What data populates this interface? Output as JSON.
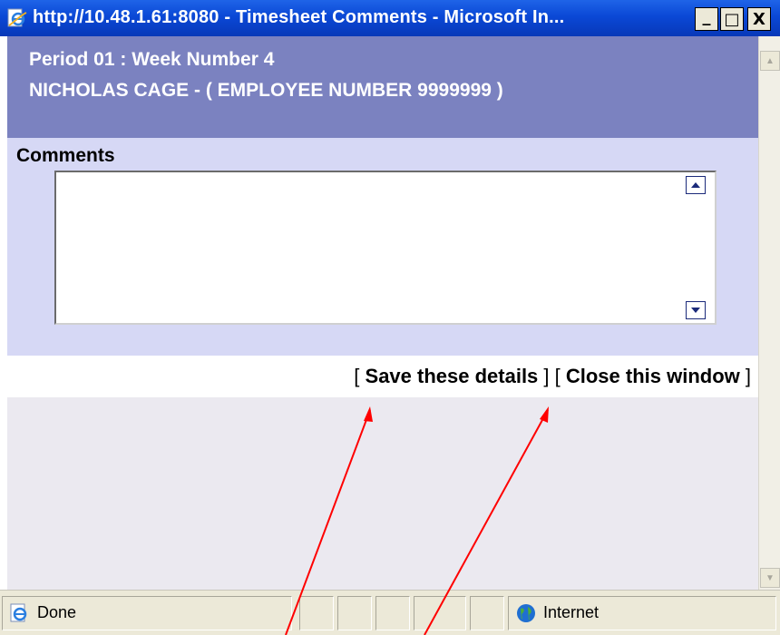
{
  "window": {
    "title": "http://10.48.1.61:8080 - Timesheet Comments - Microsoft In...",
    "minimize_label": "_",
    "maximize_label": "□",
    "close_label": "X"
  },
  "header": {
    "period": "Period 01 : Week Number 4",
    "employee": "NICHOLAS CAGE - ( EMPLOYEE NUMBER 9999999 )"
  },
  "comments": {
    "label": "Comments",
    "value": ""
  },
  "actions": {
    "open_bracket": "[ ",
    "save_label": "Save these details",
    "separator": " ] [ ",
    "close_label": "Close this window",
    "close_bracket": " ]"
  },
  "statusbar": {
    "status": "Done",
    "zone": "Internet"
  },
  "colors": {
    "titlebar": "#0a48d6",
    "header_band": "#7b82c0",
    "comments_band": "#d6d8f5",
    "page_bg": "#ebe9f0",
    "annotation_arrow": "#ff0000"
  },
  "icons": {
    "title": "ie-page-icon",
    "status": "ie-done-icon",
    "zone": "globe-icon"
  }
}
